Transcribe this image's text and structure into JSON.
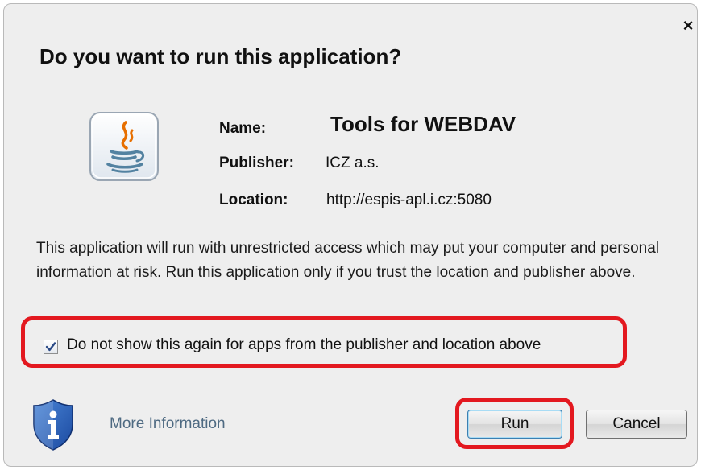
{
  "dialog": {
    "title": "Do you want to run this application?",
    "close_glyph": "×"
  },
  "app_info": {
    "icon": "java-cup-icon",
    "name_label": "Name:",
    "name_value": "Tools for WEBDAV",
    "publisher_label": "Publisher:",
    "publisher_value": "ICZ a.s.",
    "location_label": "Location:",
    "location_value": "http://espis-apl.i.cz:5080"
  },
  "warning_text": "This application will run with unrestricted access which may put your computer and personal information at risk. Run this application only if you trust the location and publisher above.",
  "checkbox": {
    "label": "Do not show this again for apps from the publisher and location above",
    "checked": true
  },
  "footer": {
    "info_icon": "info-shield-icon",
    "more_info_label": "More Information",
    "run_label": "Run",
    "cancel_label": "Cancel"
  },
  "colors": {
    "highlight": "#e3181f",
    "link": "#4e6a82",
    "dialog_bg": "#eeeeee"
  }
}
